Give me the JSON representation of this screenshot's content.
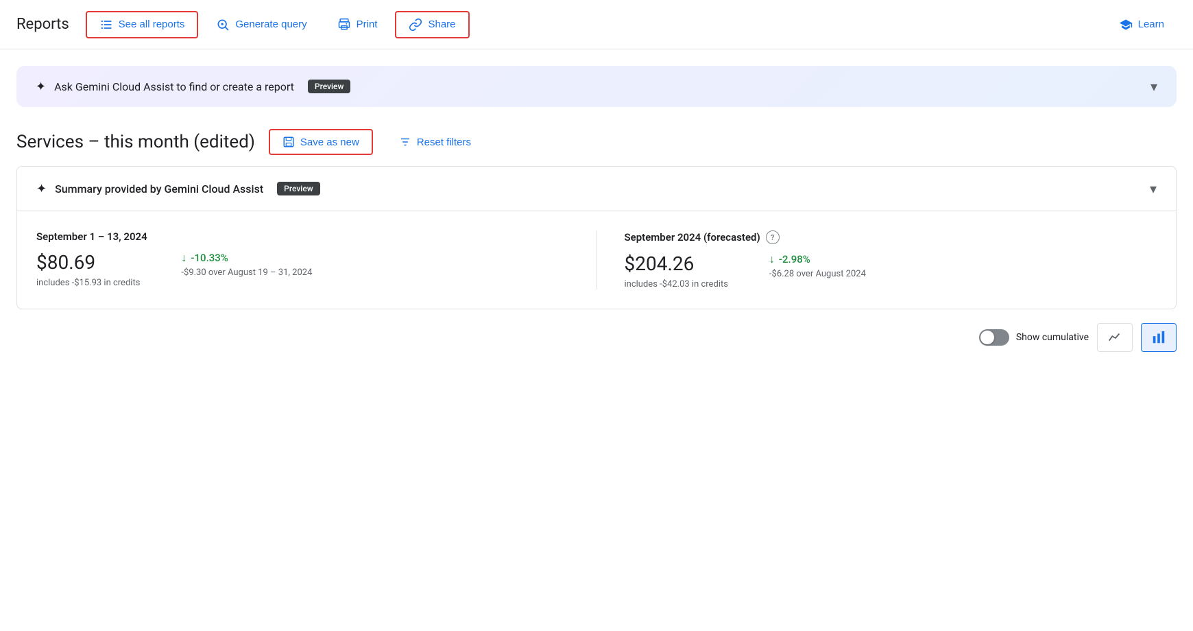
{
  "nav": {
    "title": "Reports",
    "see_all_reports": "See all reports",
    "generate_query": "Generate query",
    "print": "Print",
    "share": "Share",
    "learn": "Learn"
  },
  "gemini_banner": {
    "text": "Ask Gemini Cloud Assist to find or create a report",
    "badge": "Preview"
  },
  "report": {
    "title": "Services – this month (edited)",
    "save_as_new": "Save as new",
    "reset_filters": "Reset filters"
  },
  "summary_card": {
    "header": "Summary provided by Gemini Cloud Assist",
    "badge": "Preview",
    "col1": {
      "period": "September 1 – 13, 2024",
      "amount": "$80.69",
      "change_pct": "-10.33%",
      "credits": "includes -$15.93 in credits",
      "change_detail": "-$9.30 over August 19 – 31, 2024"
    },
    "col2": {
      "period": "September 2024 (forecasted)",
      "amount": "$204.26",
      "change_pct": "-2.98%",
      "credits": "includes -$42.03 in credits",
      "change_detail": "-$6.28 over August 2024"
    }
  },
  "bottom": {
    "show_cumulative": "Show cumulative"
  }
}
